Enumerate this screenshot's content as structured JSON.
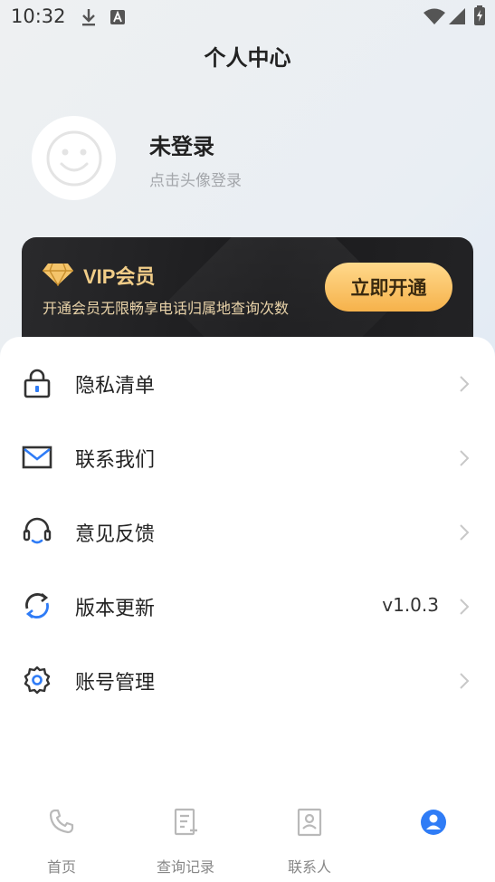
{
  "status_bar": {
    "time": "10:32",
    "icons": [
      "download-icon",
      "text-a-icon",
      "wifi-icon",
      "signal-icon",
      "battery-icon"
    ]
  },
  "header": {
    "title": "个人中心"
  },
  "profile": {
    "name": "未登录",
    "hint": "点击头像登录"
  },
  "vip": {
    "title": "VIP会员",
    "description": "开通会员无限畅享电话归属地查询次数",
    "button_label": "立即开通",
    "accent_color": "#f1cd88"
  },
  "menu": {
    "items": [
      {
        "label": "隐私清单",
        "icon": "lock-icon",
        "value": ""
      },
      {
        "label": "联系我们",
        "icon": "mail-icon",
        "value": ""
      },
      {
        "label": "意见反馈",
        "icon": "headset-icon",
        "value": ""
      },
      {
        "label": "版本更新",
        "icon": "refresh-icon",
        "value": "v1.0.3"
      },
      {
        "label": "账号管理",
        "icon": "gear-icon",
        "value": ""
      }
    ]
  },
  "bottom_nav": {
    "items": [
      {
        "label": "首页",
        "icon": "phone-icon",
        "active": false
      },
      {
        "label": "查询记录",
        "icon": "document-icon",
        "active": false
      },
      {
        "label": "联系人",
        "icon": "contacts-icon",
        "active": false
      },
      {
        "label": "",
        "icon": "user-circle-icon",
        "active": true
      }
    ],
    "active_color": "#2f7cf6"
  }
}
